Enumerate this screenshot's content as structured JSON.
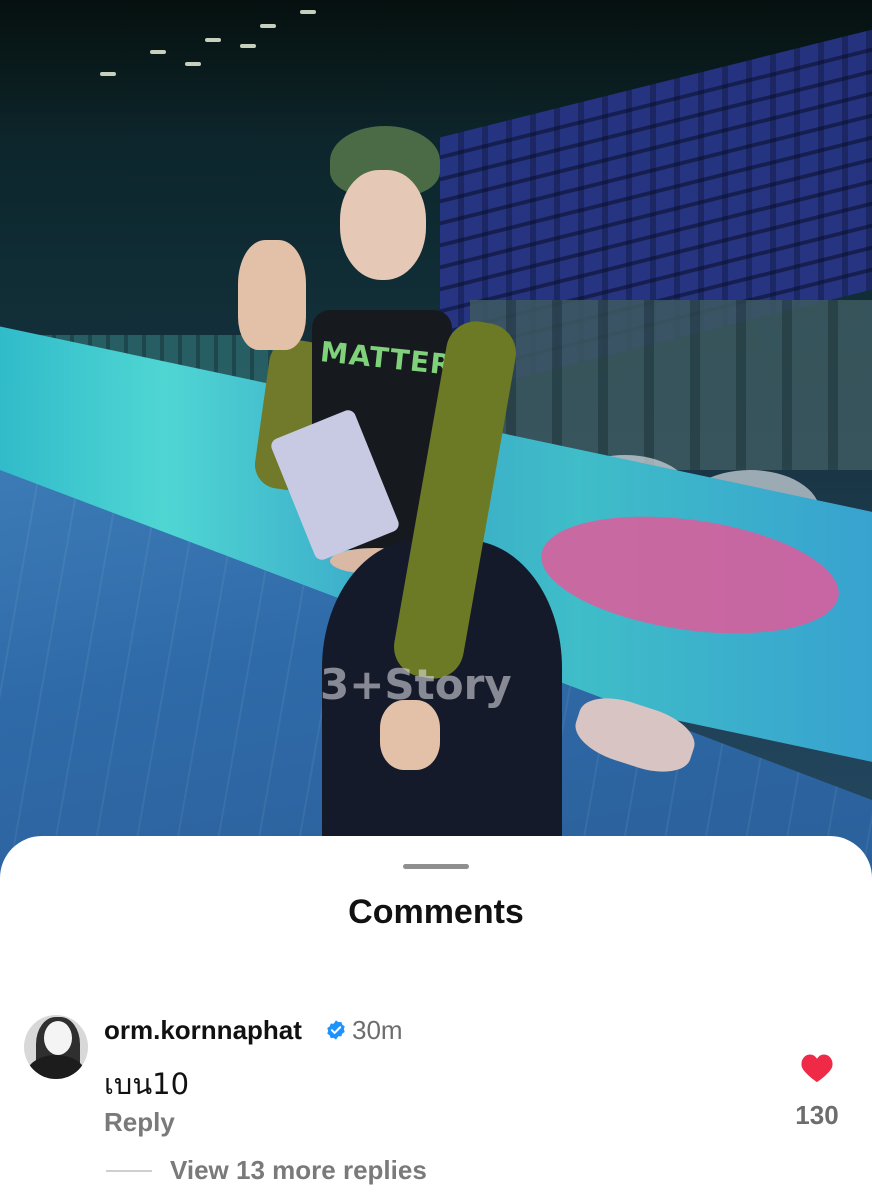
{
  "photo": {
    "shirt_text": "MATTER",
    "watermark": "3+Story"
  },
  "sheet": {
    "title": "Comments"
  },
  "comment": {
    "username": "orm.kornnaphat",
    "verified": true,
    "time": "30m",
    "text": "เบน10",
    "reply_label": "Reply",
    "likes": "130",
    "view_replies_label": "View 13 more replies"
  },
  "colors": {
    "heart": "#ee2a47",
    "verified_badge": "#1e93ff"
  }
}
